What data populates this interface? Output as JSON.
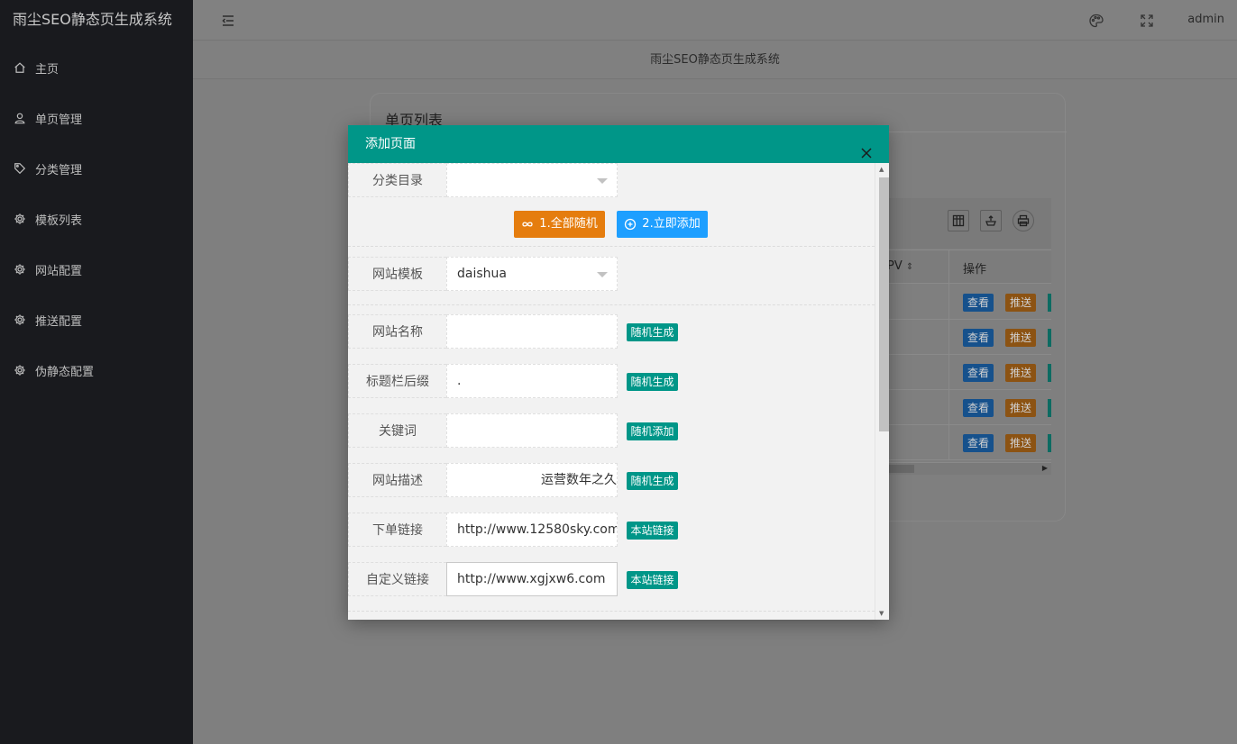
{
  "sidebar": {
    "brand": "雨尘SEO静态页生成系统",
    "items": [
      {
        "label": "主页",
        "icon": "home-icon"
      },
      {
        "label": "单页管理",
        "icon": "user-icon"
      },
      {
        "label": "分类管理",
        "icon": "tag-icon"
      },
      {
        "label": "模板列表",
        "icon": "gear-icon"
      },
      {
        "label": "网站配置",
        "icon": "gear-icon"
      },
      {
        "label": "推送配置",
        "icon": "gear-icon"
      },
      {
        "label": "伪静态配置",
        "icon": "gear-icon"
      }
    ]
  },
  "header": {
    "user": "admin",
    "subtitle": "雨尘SEO静态页生成系统"
  },
  "card": {
    "title": "单页列表",
    "table_header_pv": "PV",
    "table_header_actions": "操作",
    "row_view_label": "查看",
    "row_push_label": "推送",
    "row_count": 5
  },
  "modal": {
    "title": "添加页面",
    "fields": {
      "category": {
        "label": "分类目录",
        "value": ""
      },
      "template": {
        "label": "网站模板",
        "value": "daishua"
      },
      "site_name": {
        "label": "网站名称",
        "value": "",
        "tag": "随机生成"
      },
      "title_suffix": {
        "label": "标题栏后缀",
        "value": ".",
        "tag": "随机生成"
      },
      "keywords": {
        "label": "关键词",
        "value": "",
        "tag": "随机添加"
      },
      "description": {
        "label": "网站描述",
        "value": "运营数年之久",
        "tag": "随机生成"
      },
      "order_link": {
        "label": "下单链接",
        "value": "http://www.12580sky.com",
        "tag": "本站链接"
      },
      "custom_link": {
        "label": "自定义链接",
        "value": "http://www.xgjxw6.com",
        "tag": "本站链接"
      }
    },
    "buttons": {
      "random_all": "1.全部随机",
      "add_now": "2.立即添加"
    }
  },
  "colors": {
    "sidebar_bg": "#191a1e",
    "modal_header": "#009688",
    "btn_orange": "#e57d0e",
    "btn_blue": "#1e9fff"
  }
}
